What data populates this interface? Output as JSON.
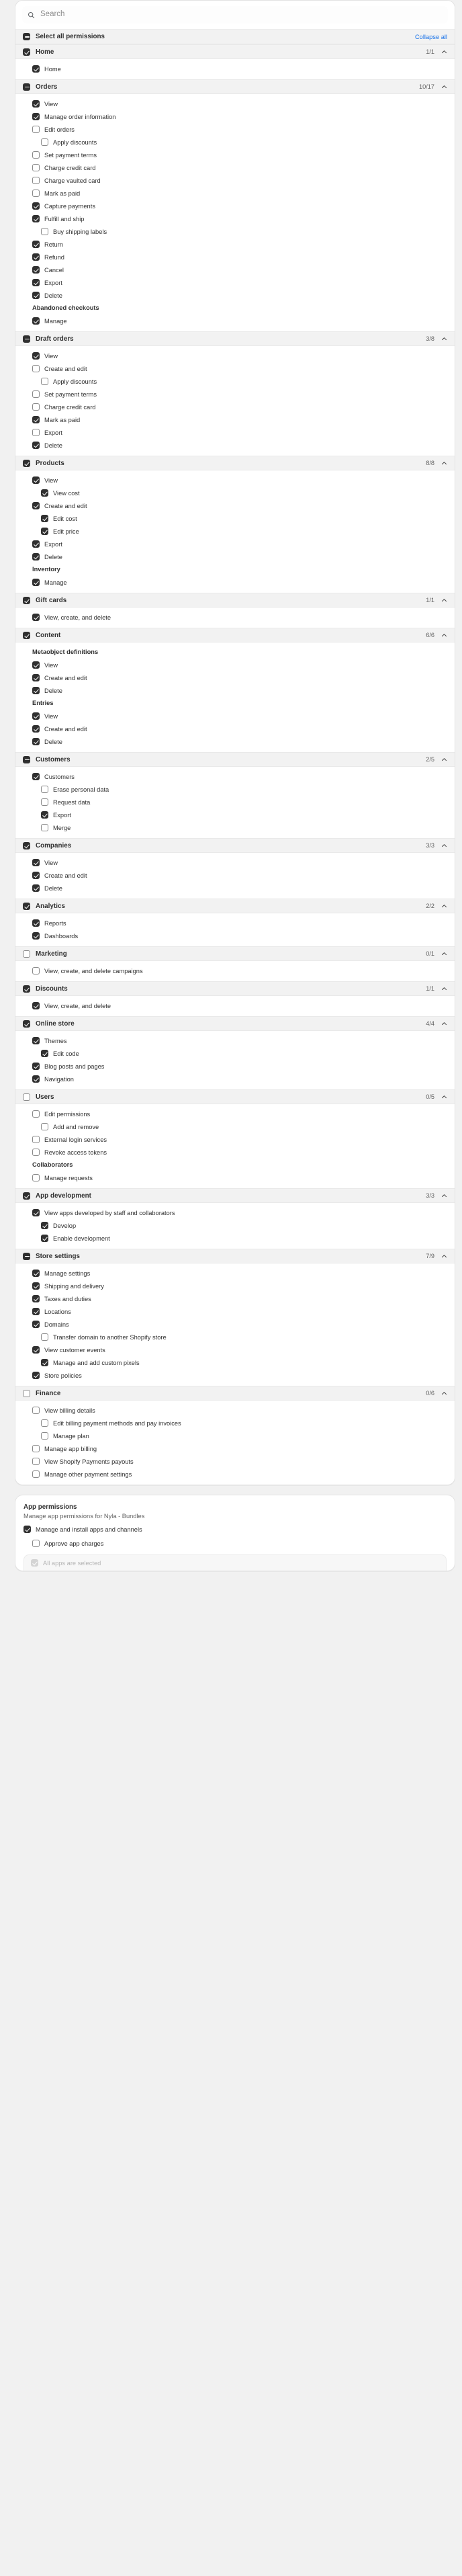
{
  "search": {
    "placeholder": "Search",
    "icon": "search-icon"
  },
  "select_all": {
    "label": "Select all permissions",
    "state": "mixed",
    "collapse_all_label": "Collapse all"
  },
  "groups": [
    {
      "id": "home",
      "label": "Home",
      "state": "on",
      "count": "1/1",
      "expanded": true,
      "items": [
        {
          "label": "Home",
          "state": "on",
          "level": 1
        }
      ]
    },
    {
      "id": "orders",
      "label": "Orders",
      "state": "mixed",
      "count": "10/17",
      "expanded": true,
      "items": [
        {
          "label": "View",
          "state": "on",
          "level": 1
        },
        {
          "label": "Manage order information",
          "state": "on",
          "level": 1
        },
        {
          "label": "Edit orders",
          "state": "off",
          "level": 1
        },
        {
          "label": "Apply discounts",
          "state": "off",
          "level": 2
        },
        {
          "label": "Set payment terms",
          "state": "off",
          "level": 1
        },
        {
          "label": "Charge credit card",
          "state": "off",
          "level": 1
        },
        {
          "label": "Charge vaulted card",
          "state": "off",
          "level": 1
        },
        {
          "label": "Mark as paid",
          "state": "off",
          "level": 1
        },
        {
          "label": "Capture payments",
          "state": "on",
          "level": 1
        },
        {
          "label": "Fulfill and ship",
          "state": "on",
          "level": 1
        },
        {
          "label": "Buy shipping labels",
          "state": "off",
          "level": 2
        },
        {
          "label": "Return",
          "state": "on",
          "level": 1
        },
        {
          "label": "Refund",
          "state": "on",
          "level": 1
        },
        {
          "label": "Cancel",
          "state": "on",
          "level": 1
        },
        {
          "label": "Export",
          "state": "on",
          "level": 1
        },
        {
          "label": "Delete",
          "state": "on",
          "level": 1
        },
        {
          "label": "Abandoned checkouts",
          "type": "subhead"
        },
        {
          "label": "Manage",
          "state": "on",
          "level": 1
        }
      ]
    },
    {
      "id": "draft-orders",
      "label": "Draft orders",
      "state": "mixed",
      "count": "3/8",
      "expanded": true,
      "items": [
        {
          "label": "View",
          "state": "on",
          "level": 1
        },
        {
          "label": "Create and edit",
          "state": "off",
          "level": 1
        },
        {
          "label": "Apply discounts",
          "state": "off",
          "level": 2
        },
        {
          "label": "Set payment terms",
          "state": "off",
          "level": 1
        },
        {
          "label": "Charge credit card",
          "state": "off",
          "level": 1
        },
        {
          "label": "Mark as paid",
          "state": "on",
          "level": 1
        },
        {
          "label": "Export",
          "state": "off",
          "level": 1
        },
        {
          "label": "Delete",
          "state": "on",
          "level": 1
        }
      ]
    },
    {
      "id": "products",
      "label": "Products",
      "state": "on",
      "count": "8/8",
      "expanded": true,
      "items": [
        {
          "label": "View",
          "state": "on",
          "level": 1
        },
        {
          "label": "View cost",
          "state": "on",
          "level": 2
        },
        {
          "label": "Create and edit",
          "state": "on",
          "level": 1
        },
        {
          "label": "Edit cost",
          "state": "on",
          "level": 2
        },
        {
          "label": "Edit price",
          "state": "on",
          "level": 2
        },
        {
          "label": "Export",
          "state": "on",
          "level": 1
        },
        {
          "label": "Delete",
          "state": "on",
          "level": 1
        },
        {
          "label": "Inventory",
          "type": "subhead"
        },
        {
          "label": "Manage",
          "state": "on",
          "level": 1
        }
      ]
    },
    {
      "id": "gift-cards",
      "label": "Gift cards",
      "state": "on",
      "count": "1/1",
      "expanded": true,
      "items": [
        {
          "label": "View, create, and delete",
          "state": "on",
          "level": 1
        }
      ]
    },
    {
      "id": "content",
      "label": "Content",
      "state": "on",
      "count": "6/6",
      "expanded": true,
      "items": [
        {
          "label": "Metaobject definitions",
          "type": "subhead"
        },
        {
          "label": "View",
          "state": "on",
          "level": 1
        },
        {
          "label": "Create and edit",
          "state": "on",
          "level": 1
        },
        {
          "label": "Delete",
          "state": "on",
          "level": 1
        },
        {
          "label": "Entries",
          "type": "subhead"
        },
        {
          "label": "View",
          "state": "on",
          "level": 1
        },
        {
          "label": "Create and edit",
          "state": "on",
          "level": 1
        },
        {
          "label": "Delete",
          "state": "on",
          "level": 1
        }
      ]
    },
    {
      "id": "customers",
      "label": "Customers",
      "state": "mixed",
      "count": "2/5",
      "expanded": true,
      "items": [
        {
          "label": "Customers",
          "state": "on",
          "level": 1
        },
        {
          "label": "Erase personal data",
          "state": "off",
          "level": 2
        },
        {
          "label": "Request data",
          "state": "off",
          "level": 2
        },
        {
          "label": "Export",
          "state": "on",
          "level": 2
        },
        {
          "label": "Merge",
          "state": "off",
          "level": 2
        }
      ]
    },
    {
      "id": "companies",
      "label": "Companies",
      "state": "on",
      "count": "3/3",
      "expanded": true,
      "items": [
        {
          "label": "View",
          "state": "on",
          "level": 1
        },
        {
          "label": "Create and edit",
          "state": "on",
          "level": 1
        },
        {
          "label": "Delete",
          "state": "on",
          "level": 1
        }
      ]
    },
    {
      "id": "analytics",
      "label": "Analytics",
      "state": "on",
      "count": "2/2",
      "expanded": true,
      "items": [
        {
          "label": "Reports",
          "state": "on",
          "level": 1
        },
        {
          "label": "Dashboards",
          "state": "on",
          "level": 1
        }
      ]
    },
    {
      "id": "marketing",
      "label": "Marketing",
      "state": "off",
      "count": "0/1",
      "expanded": true,
      "items": [
        {
          "label": "View, create, and delete campaigns",
          "state": "off",
          "level": 1
        }
      ]
    },
    {
      "id": "discounts",
      "label": "Discounts",
      "state": "on",
      "count": "1/1",
      "expanded": true,
      "items": [
        {
          "label": "View, create, and delete",
          "state": "on",
          "level": 1
        }
      ]
    },
    {
      "id": "online-store",
      "label": "Online store",
      "state": "on",
      "count": "4/4",
      "expanded": true,
      "items": [
        {
          "label": "Themes",
          "state": "on",
          "level": 1
        },
        {
          "label": "Edit code",
          "state": "on",
          "level": 2
        },
        {
          "label": "Blog posts and pages",
          "state": "on",
          "level": 1
        },
        {
          "label": "Navigation",
          "state": "on",
          "level": 1
        }
      ]
    },
    {
      "id": "users",
      "label": "Users",
      "state": "off",
      "count": "0/5",
      "expanded": true,
      "items": [
        {
          "label": "Edit permissions",
          "state": "off",
          "level": 1
        },
        {
          "label": "Add and remove",
          "state": "off",
          "level": 2
        },
        {
          "label": "External login services",
          "state": "off",
          "level": 1
        },
        {
          "label": "Revoke access tokens",
          "state": "off",
          "level": 1
        },
        {
          "label": "Collaborators",
          "type": "subhead"
        },
        {
          "label": "Manage requests",
          "state": "off",
          "level": 1
        }
      ]
    },
    {
      "id": "app-development",
      "label": "App development",
      "state": "on",
      "count": "3/3",
      "expanded": true,
      "items": [
        {
          "label": "View apps developed by staff and collaborators",
          "state": "on",
          "level": 1
        },
        {
          "label": "Develop",
          "state": "on",
          "level": 2
        },
        {
          "label": "Enable development",
          "state": "on",
          "level": 2
        }
      ]
    },
    {
      "id": "store-settings",
      "label": "Store settings",
      "state": "mixed",
      "count": "7/9",
      "expanded": true,
      "items": [
        {
          "label": "Manage settings",
          "state": "on",
          "level": 1
        },
        {
          "label": "Shipping and delivery",
          "state": "on",
          "level": 1
        },
        {
          "label": "Taxes and duties",
          "state": "on",
          "level": 1
        },
        {
          "label": "Locations",
          "state": "on",
          "level": 1
        },
        {
          "label": "Domains",
          "state": "on",
          "level": 1
        },
        {
          "label": "Transfer domain to another Shopify store",
          "state": "off",
          "level": 2
        },
        {
          "label": "View customer events",
          "state": "on",
          "level": 1
        },
        {
          "label": "Manage and add custom pixels",
          "state": "on",
          "level": 2
        },
        {
          "label": "Store policies",
          "state": "on",
          "level": 1
        }
      ]
    },
    {
      "id": "finance",
      "label": "Finance",
      "state": "off",
      "count": "0/6",
      "expanded": true,
      "items": [
        {
          "label": "View billing details",
          "state": "off",
          "level": 1
        },
        {
          "label": "Edit billing payment methods and pay invoices",
          "state": "off",
          "level": 2
        },
        {
          "label": "Manage plan",
          "state": "off",
          "level": 2
        },
        {
          "label": "Manage app billing",
          "state": "off",
          "level": 1
        },
        {
          "label": "View Shopify Payments payouts",
          "state": "off",
          "level": 1
        },
        {
          "label": "Manage other payment settings",
          "state": "off",
          "level": 1
        }
      ]
    }
  ],
  "app_permissions": {
    "title": "App permissions",
    "subtitle": "Manage app permissions for Nyla - Bundles",
    "manage_install": {
      "label": "Manage and install apps and channels",
      "state": "on"
    },
    "approve_charges": {
      "label": "Approve app charges",
      "state": "off"
    },
    "all_apps": {
      "label": "All apps are selected",
      "state": "disabled-on"
    }
  },
  "colors": {
    "accent": "#1a73e8",
    "checked": "#303030",
    "header_bg": "#f2f2f2",
    "page_bg": "#f1f1f1"
  }
}
